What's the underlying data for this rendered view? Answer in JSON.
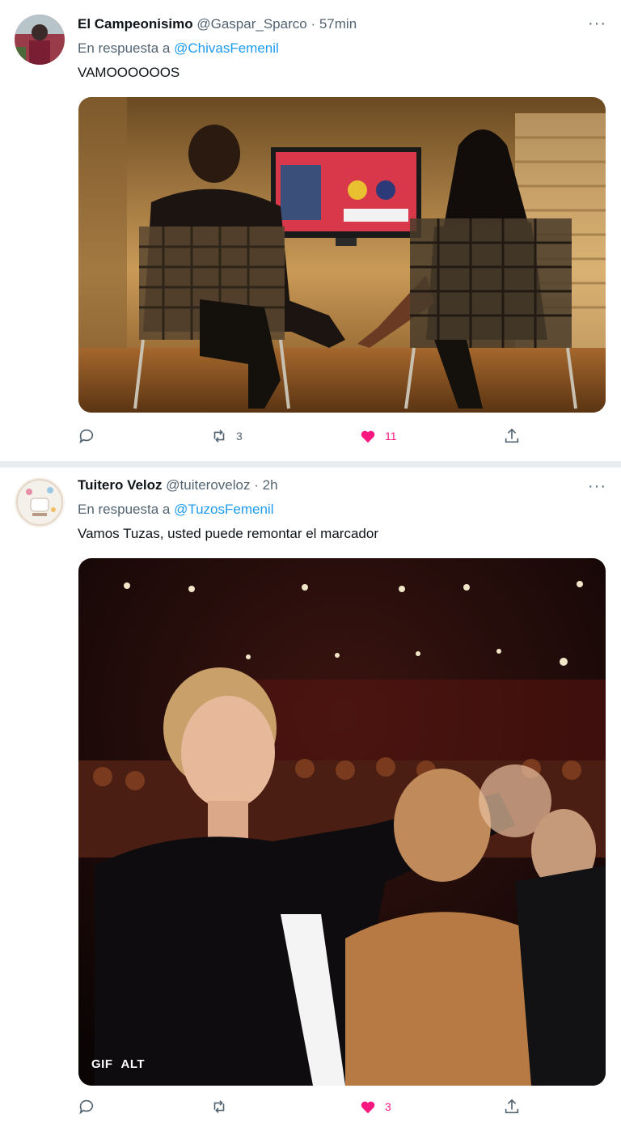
{
  "tweets": [
    {
      "name": "El Campeonisimo",
      "handle": "@Gaspar_Sparco",
      "time": "57min",
      "reply_prefix": "En respuesta a",
      "reply_to": "@ChivasFemenil",
      "text": "VAMOOOOOOS",
      "retweets": "3",
      "likes": "11"
    },
    {
      "name": "Tuitero Veloz",
      "handle": "@tuiteroveloz",
      "time": "2h",
      "reply_prefix": "En respuesta a",
      "reply_to": "@TuzosFemenil",
      "text": "Vamos Tuzas, usted puede remontar el marcador",
      "media_badges": [
        "GIF",
        "ALT"
      ],
      "retweets": "",
      "likes": "3"
    }
  ],
  "separator": "·",
  "more": "···",
  "colors": {
    "accent": "#1d9bf0",
    "like": "#f91880",
    "secondary": "#536471"
  }
}
